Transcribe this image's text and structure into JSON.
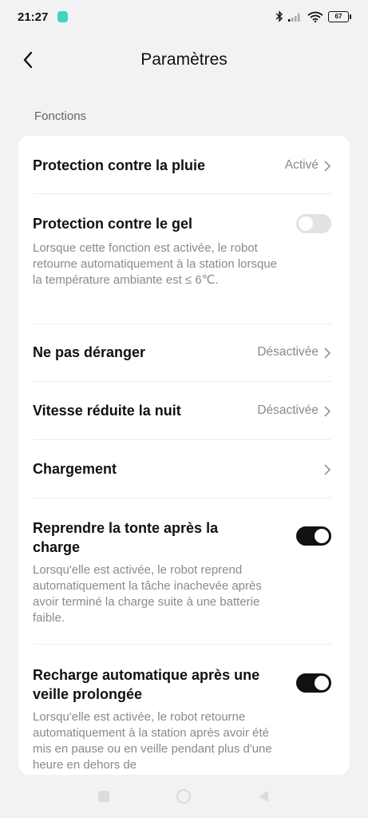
{
  "status_bar": {
    "time": "21:27",
    "battery": "67"
  },
  "header": {
    "title": "Paramètres"
  },
  "section": {
    "label": "Fonctions"
  },
  "settings": {
    "rain": {
      "title": "Protection contre la pluie",
      "value": "Activé"
    },
    "frost": {
      "title": "Protection contre le gel",
      "description": "Lorsque cette fonction est activée, le robot retourne automatiquement à la station lorsque la température ambiante est ≤ 6℃.",
      "enabled": false
    },
    "dnd": {
      "title": "Ne pas déranger",
      "value": "Désactivée"
    },
    "night_speed": {
      "title": "Vitesse réduite la nuit",
      "value": "Désactivée"
    },
    "charging": {
      "title": "Chargement"
    },
    "resume_mowing": {
      "title": "Reprendre la tonte après la charge",
      "description": "Lorsqu'elle est activée, le robot reprend automatiquement la tâche inachevée après avoir terminé la charge suite à une batterie faible.",
      "enabled": true
    },
    "auto_recharge": {
      "title": "Recharge automatique après une veille prolongée",
      "description": "Lorsqu'elle est activée, le robot retourne automatiquement à la station après avoir été mis en pause ou en veille pendant plus d'une heure en dehors de",
      "enabled": true
    }
  },
  "icons": {
    "back": "chevron-left-icon",
    "chevron": "chevron-right-icon",
    "nav_recent": "square-icon",
    "nav_home": "circle-icon",
    "nav_back": "triangle-icon"
  }
}
